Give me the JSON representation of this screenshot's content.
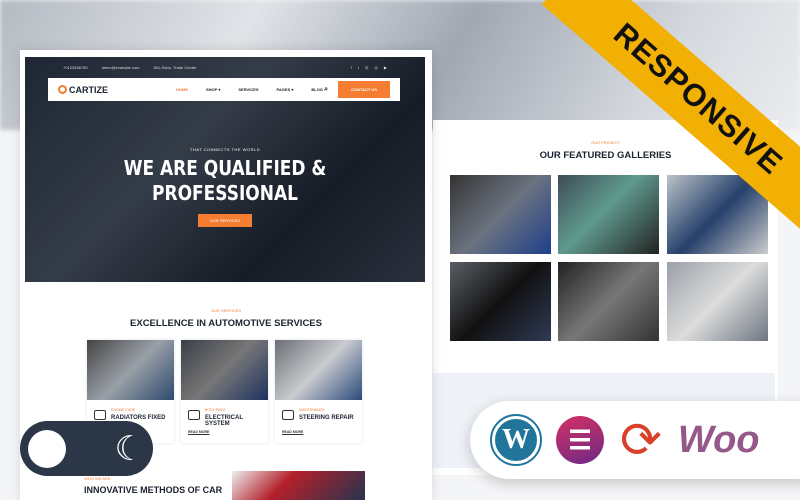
{
  "ribbon": "RESPONSIVE",
  "topbar": {
    "phone": "+0123456789",
    "email": "demo@example.com",
    "address": "501-Sobo, Trade Center",
    "social": [
      "f",
      "t",
      "◎",
      "◎",
      "▶"
    ]
  },
  "nav": {
    "logo": "CARTIZE",
    "items": [
      "HOME",
      "SHOP ▾",
      "SERVICES",
      "PAGES ▾",
      "BLOG"
    ],
    "contact": "CONTACT US"
  },
  "hero": {
    "tagline": "THAT CONNECTS THE WORLD",
    "title_line1": "WE ARE QUALIFIED &",
    "title_line2": "PROFESSIONAL",
    "button": "OUR SERVICES"
  },
  "services": {
    "tag": "OUR SERVICES",
    "title": "EXCELLENCE IN AUTOMOTIVE SERVICES",
    "items": [
      {
        "tag": "ENGINE CARE",
        "name": "RADIATORS FIXED",
        "link": "READ MORE"
      },
      {
        "tag": "BODY PAINT",
        "name": "ELECTRICAL SYSTEM",
        "link": "READ MORE"
      },
      {
        "tag": "MAINTENANCE",
        "name": "STEERING REPAIR",
        "link": "READ MORE"
      }
    ]
  },
  "about": {
    "tag": "WHO WE ARE",
    "title": "INNOVATIVE METHODS OF CAR"
  },
  "gallery": {
    "tag": "OUR PROJECT",
    "title": "OUR FEATURED GALLERIES"
  },
  "plugins": [
    "WordPress",
    "Elementor",
    "Updates",
    "Woo"
  ],
  "colors": {
    "accent": "#f47d31",
    "ribbon": "#f2b005",
    "dark": "#2b3646"
  }
}
